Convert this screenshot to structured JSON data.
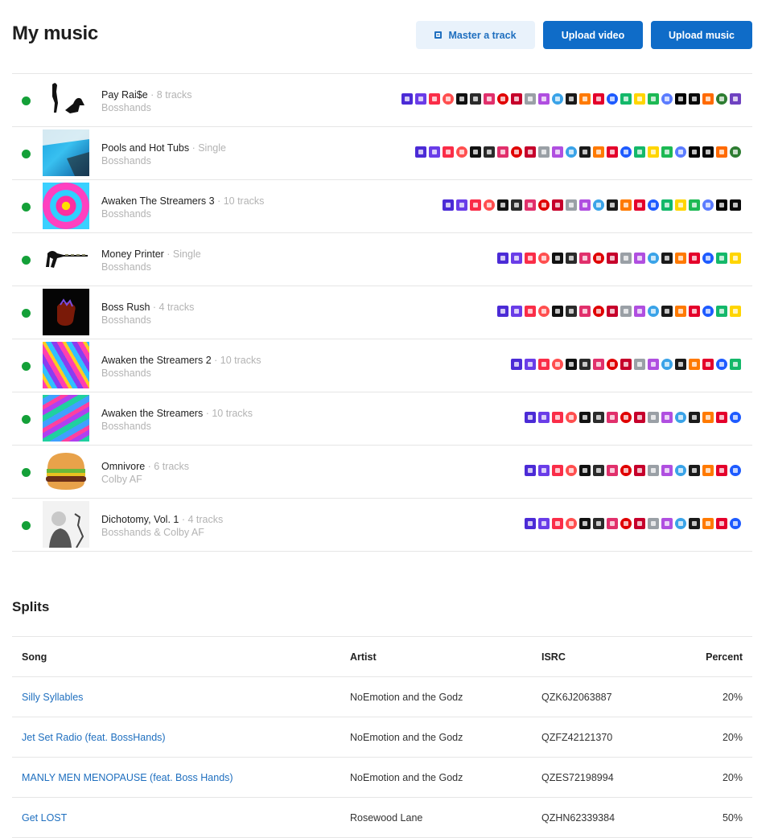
{
  "header": {
    "title": "My music",
    "master_label": "Master a track",
    "upload_video_label": "Upload video",
    "upload_music_label": "Upload music"
  },
  "releases": [
    {
      "title": "Pay Rai$e",
      "meta": " · 8 tracks",
      "artist": "Bosshands",
      "icon_count": 25,
      "cover": "silhouettes"
    },
    {
      "title": "Pools and Hot Tubs",
      "meta": " · Single",
      "artist": "Bosshands",
      "icon_count": 24,
      "cover": "blue-abstract"
    },
    {
      "title": "Awaken The Streamers 3",
      "meta": " · 10 tracks",
      "artist": "Bosshands",
      "icon_count": 22,
      "cover": "kaleidoscope"
    },
    {
      "title": "Money Printer",
      "meta": " · Single",
      "artist": "Bosshands",
      "icon_count": 18,
      "cover": "gunman"
    },
    {
      "title": "Boss Rush",
      "meta": " · 4 tracks",
      "artist": "Bosshands",
      "icon_count": 18,
      "cover": "fist"
    },
    {
      "title": "Awaken the Streamers 2",
      "meta": " · 10 tracks",
      "artist": "Bosshands",
      "icon_count": 17,
      "cover": "swirl"
    },
    {
      "title": "Awaken the Streamers",
      "meta": " · 10 tracks",
      "artist": "Bosshands",
      "icon_count": 16,
      "cover": "swirl-green"
    },
    {
      "title": "Omnivore",
      "meta": " · 6 tracks",
      "artist": "Colby AF",
      "icon_count": 16,
      "cover": "burger"
    },
    {
      "title": "Dichotomy, Vol. 1",
      "meta": " · 4 tracks",
      "artist": "Bosshands & Colby AF",
      "icon_count": 16,
      "cover": "portrait"
    }
  ],
  "icon_colors": [
    "#4b2bd6",
    "#6a3de8",
    "#fa2d48",
    "#ff4f4f",
    "#111111",
    "#2b2b2b",
    "#e1306c",
    "#e00000",
    "#c6002b",
    "#9aa0a6",
    "#b04fe0",
    "#3aa3e8",
    "#1a1a1a",
    "#ff7a00",
    "#e4002b",
    "#1e5bff",
    "#14b86a",
    "#ffd500",
    "#1db954",
    "#5b7cff",
    "#000000",
    "#0a0a0a",
    "#ff6a00",
    "#2e7d32",
    "#6f42c1"
  ],
  "splits": {
    "title": "Splits",
    "columns": [
      "Song",
      "Artist",
      "ISRC",
      "Percent"
    ],
    "rows": [
      {
        "song": "Silly Syllables",
        "artist": "NoEmotion and the Godz",
        "isrc": "QZK6J2063887",
        "percent": "20%"
      },
      {
        "song": "Jet Set Radio (feat. BossHands)",
        "artist": "NoEmotion and the Godz",
        "isrc": "QZFZ42121370",
        "percent": "20%"
      },
      {
        "song": "MANLY MEN MENOPAUSE (feat. Boss Hands)",
        "artist": "NoEmotion and the Godz",
        "isrc": "QZES72198994",
        "percent": "20%"
      },
      {
        "song": "Get LOST",
        "artist": "Rosewood Lane",
        "isrc": "QZHN62339384",
        "percent": "50%"
      }
    ]
  }
}
